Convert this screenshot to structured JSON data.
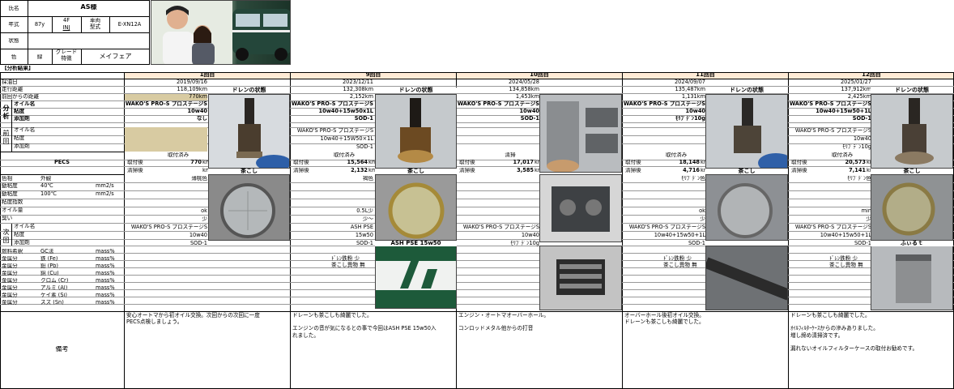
{
  "profile": {
    "name_label": "氏名",
    "name": "AS様",
    "year_label": "年式",
    "year": "87y",
    "spec1": "4F",
    "spec2": "INJ",
    "model_label": "車両\n型式",
    "model": "E-XN12A",
    "condition_label": "状態",
    "condition": "",
    "color_label": "色",
    "color": "緑",
    "grade_label": "グレード\n特徴",
    "grade": "メイフェア"
  },
  "analysis_header": "【分析結果】",
  "row_labels": {
    "sample_date": "採油日",
    "mileage": "走行距離",
    "since_last": "前回からの距離",
    "group_analysis": "分\n析",
    "oil_name": "オイル名",
    "viscosity": "粘度",
    "additive": "添加剤",
    "group_prev": "前\n回",
    "oil_name2": "オイル名",
    "viscosity2": "粘度",
    "additive2": "添加剤",
    "pecs": "PECS",
    "color": "色相",
    "appearance": "外観",
    "kv40": "動粘度",
    "kv40_temp": "40℃",
    "kv40_unit": "mm2/s",
    "kv100": "動粘度",
    "kv100_temp": "100℃",
    "kv100_unit": "mm2/s",
    "vi": "粘度指数",
    "oil_amount": "オイル量",
    "smell": "臭い",
    "group_next": "次\n回",
    "oil_name3": "オイル名",
    "viscosity3": "粘度",
    "additive3": "添加剤",
    "elem": "燃料希釈",
    "elem_gc": "GC法",
    "elem_unit": "mass%",
    "metals": [
      {
        "label": "金属分",
        "name": "鉄 (Fe)",
        "unit": "mass%"
      },
      {
        "label": "金属分",
        "name": "鉛 (Pb)",
        "unit": "mass%"
      },
      {
        "label": "金属分",
        "name": "銅 (Cu)",
        "unit": "mass%"
      },
      {
        "label": "金属分",
        "name": "クロム (Cr)",
        "unit": "mass%"
      },
      {
        "label": "金属分",
        "name": "アルミ (Al)",
        "unit": "mass%"
      },
      {
        "label": "金属分",
        "name": "ケイ素 (Si)",
        "unit": "mass%"
      },
      {
        "label": "金属分",
        "name": "スズ (Sn)",
        "unit": "mass%"
      }
    ],
    "remarks": "備考"
  },
  "common": {
    "installed": "取付済み",
    "before": "取付後",
    "after": "清掃後",
    "km": "km",
    "drain": "ドレンの状態",
    "strainer": "茶こし"
  },
  "cols": [
    {
      "title": "1回目",
      "date": "2019/09/16",
      "mileage": "118,109km",
      "since": "770km",
      "oil": "WAKO'S PRO-S プロステージS",
      "visc": "10w40",
      "add": "なし",
      "prev_oil": "",
      "prev_visc": "",
      "prev_add": "",
      "pecs_before": "770",
      "pecs_after": "",
      "p_color": "薄桃色",
      "kv40": "",
      "kv100": "",
      "vi": "",
      "amount": "ok",
      "smell": "少",
      "next_oil": "WAKO'S PRO-S プロステージS",
      "next_visc": "10w40",
      "next_add": "SOD-1",
      "note": "",
      "remarks": "安心オートマから初オイル交換。次回からの次回に一度\nPECS点検しましょう。"
    },
    {
      "title": "9回目",
      "date": "2023/12/11",
      "mileage": "132,308km",
      "since": "2,152km",
      "oil": "WAKO'S PRO-S プロステージS",
      "visc": "10w40+15w50x1L",
      "add": "SOD-1",
      "prev_oil": "WAKO'S PRO-S プロステージS",
      "prev_visc": "10w40＋15W50×1L",
      "prev_add": "SOD-1",
      "pecs_before": "15,564",
      "pecs_after": "2,132",
      "p_color": "褐色",
      "kv40": "",
      "kv100": "",
      "vi": "",
      "amount": "0.5L少",
      "smell": "少～",
      "next_oil": "ASH PSE",
      "next_visc": "15w50",
      "next_add": "SOD-1",
      "note": "ﾄﾞﾚﾝ鉄粉 少\n茶こし異物 無",
      "photo_label": "ASH PSE 15w50",
      "remarks": "ドレーンも茶こしも綺麗でした。\n\nエンジンの音が気になるとの事で今回はASH PSE 15w50入\nれました。"
    },
    {
      "title": "10回目",
      "date": "2024/05/28",
      "mileage": "134,858km",
      "since": "1,453km",
      "oil": "WAKO'S PRO-S プロステージS",
      "visc": "10w40",
      "add": "SOD-1",
      "prev_oil": "",
      "prev_visc": "",
      "prev_add": "",
      "pecs_installed": "清掃",
      "pecs_before": "17,017",
      "pecs_after": "3,585",
      "p_color": "",
      "kv40": "",
      "kv100": "",
      "vi": "",
      "amount": "",
      "smell": "",
      "next_oil": "WAKO'S PRO-S プロステージS",
      "next_visc": "10w40",
      "next_add": "ﾓﾘﾌﾞﾃﾞﾝ10g",
      "note": "",
      "remarks": "エンジン・オートマオーバーホール。\n\nコンロッドメタル他からの打音"
    },
    {
      "title": "11回目",
      "date": "2024/09/07",
      "mileage": "135,487km",
      "since": "1,131km",
      "oil": "WAKO'S PRO-S プロステージS",
      "visc": "10w40",
      "add": "ﾓﾘﾌﾞﾃﾞﾝ10g",
      "prev_oil": "",
      "prev_visc": "",
      "prev_add": "",
      "pecs_before": "18,148",
      "pecs_after": "4,716",
      "p_color": "ﾓﾘﾌﾞﾃﾞﾝ色",
      "kv40": "",
      "kv100": "",
      "vi": "",
      "amount": "ok",
      "smell": "少",
      "next_oil": "WAKO'S PRO-S プロステージS",
      "next_visc": "10w40+15w50+1L",
      "next_add": "SOD-1",
      "note": "ﾄﾞﾚﾝ鉄粉 少\n茶こし異物 無",
      "remarks": "オーバーホール後初オイル交換。\nドレーンも茶こしも綺麗でした。"
    },
    {
      "title": "12回目",
      "date": "2025/01/27",
      "mileage": "137,912km",
      "since": "2,425km",
      "oil": "WAKO'S PRO-S プロステージS",
      "visc": "10w40+15w50+1L",
      "add": "SOD-1",
      "prev_oil": "WAKO'S PRO-S プロステージS",
      "prev_visc": "10w40",
      "prev_add": "ﾓﾘﾌﾞﾃﾞﾝ10g",
      "pecs_before": "20,573",
      "pecs_after": "7,141",
      "p_color": "ﾓﾘﾌﾞﾃﾞﾝ色",
      "kv40": "",
      "kv100": "",
      "vi": "",
      "amount": "min",
      "smell": "少",
      "next_oil": "WAKO'S PRO-S プロステージS",
      "next_visc": "10w40+15w50+1L",
      "next_add": "SOD-1",
      "note": "ﾄﾞﾚﾝ鉄粉 少\n茶こし異物 無",
      "photo_label": "ふぃるｔ",
      "remarks": "ドレーンも茶こしも綺麗でした。\n\nｵｲﾙﾌｨﾙﾀｰｹｰｽからの滲みありました。\n増し締め清掃済です。\n\n漏れないオイルフィルターケースの取付お勧めです。"
    }
  ],
  "colors": {
    "header": "#ffebd6",
    "beige": "#d8cba2",
    "grid": "#9a9a9a"
  }
}
